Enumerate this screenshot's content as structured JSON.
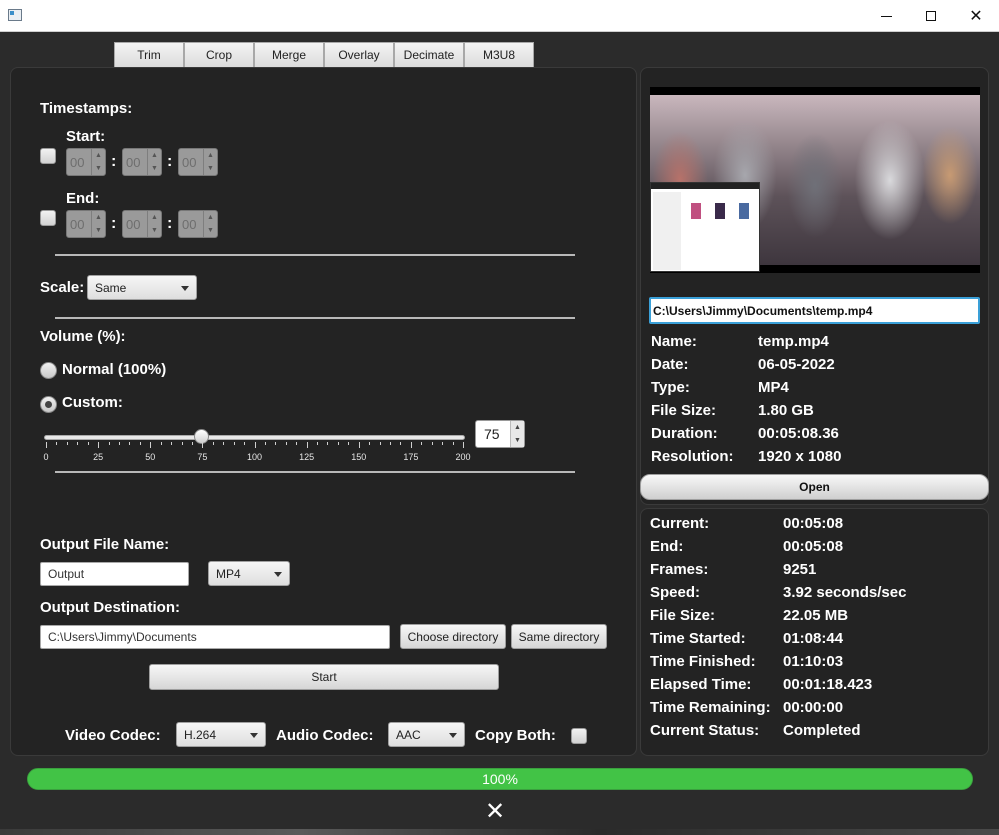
{
  "window": {
    "min_glyph": "",
    "max_glyph": "",
    "close_glyph": "✕"
  },
  "tabs": [
    "Trim",
    "Crop",
    "Merge",
    "Overlay",
    "Decimate",
    "M3U8"
  ],
  "timestamps": {
    "title": "Timestamps:",
    "start_label": "Start:",
    "end_label": "End:",
    "start": [
      "00",
      "00",
      "00"
    ],
    "end": [
      "00",
      "00",
      "00"
    ],
    "colon": ":"
  },
  "scale": {
    "label": "Scale:",
    "value": "Same"
  },
  "volume": {
    "title": "Volume (%):",
    "normal_label": "Normal (100%)",
    "custom_label": "Custom:",
    "selected": "custom",
    "value": "75",
    "slider_value": 75,
    "slider_min": 0,
    "slider_max": 200,
    "tick_labels": [
      "0",
      "25",
      "50",
      "75",
      "100",
      "125",
      "150",
      "175",
      "200"
    ]
  },
  "output": {
    "file_name_label": "Output File Name:",
    "file_name": "Output",
    "format": "MP4",
    "destination_label": "Output Destination:",
    "destination": "C:\\Users\\Jimmy\\Documents",
    "choose_directory": "Choose directory",
    "same_directory": "Same directory",
    "start": "Start"
  },
  "codecs": {
    "video_label": "Video Codec:",
    "video_value": "H.264",
    "audio_label": "Audio Codec:",
    "audio_value": "AAC",
    "copy_both_label": "Copy Both:"
  },
  "file": {
    "path": "C:\\Users\\Jimmy\\Documents\\temp.mp4",
    "info": [
      {
        "key": "Name:",
        "value": "temp.mp4"
      },
      {
        "key": "Date:",
        "value": "06-05-2022"
      },
      {
        "key": "Type:",
        "value": "MP4"
      },
      {
        "key": "File Size:",
        "value": "1.80 GB"
      },
      {
        "key": "Duration:",
        "value": "00:05:08.36"
      },
      {
        "key": "Resolution:",
        "value": "1920 x 1080"
      }
    ],
    "open_label": "Open"
  },
  "status": [
    {
      "key": "Current:",
      "value": "00:05:08"
    },
    {
      "key": "End:",
      "value": "00:05:08"
    },
    {
      "key": "Frames:",
      "value": "9251"
    },
    {
      "key": "Speed:",
      "value": "3.92 seconds/sec"
    },
    {
      "key": "File Size:",
      "value": "22.05 MB"
    },
    {
      "key": "Time Started:",
      "value": "01:08:44"
    },
    {
      "key": "Time Finished:",
      "value": "01:10:03"
    },
    {
      "key": "Elapsed Time:",
      "value": "00:01:18.423"
    },
    {
      "key": "Time Remaining:",
      "value": "00:00:00"
    },
    {
      "key": "Current Status:",
      "value": "Completed"
    }
  ],
  "progress": {
    "percent": 100,
    "label": "100%"
  },
  "cancel_glyph": "✕",
  "colors": {
    "progress": "#42c346",
    "panel": "#232323",
    "background": "#2b2b2b",
    "focus": "#3aa0d8"
  }
}
